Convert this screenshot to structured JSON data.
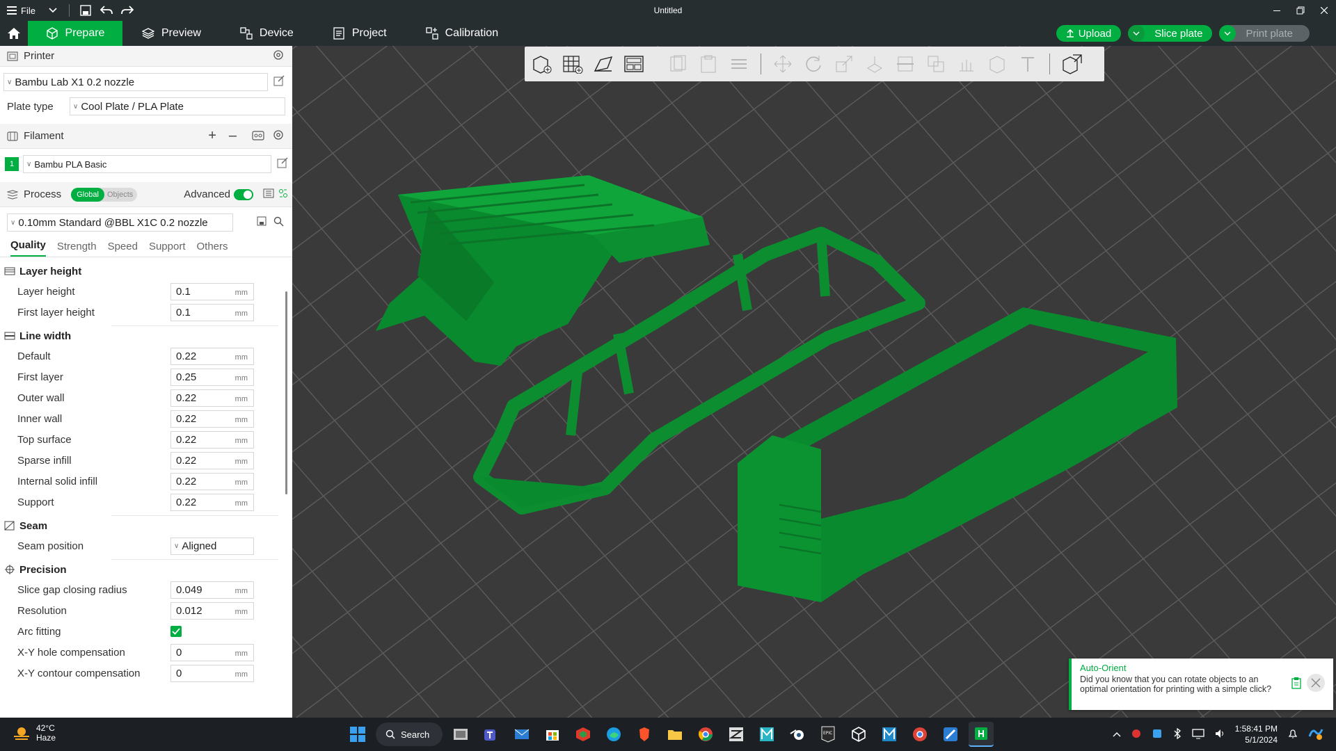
{
  "window": {
    "file_menu": "File",
    "title": "Untitled"
  },
  "nav": {
    "tabs": [
      {
        "label": "Prepare"
      },
      {
        "label": "Preview"
      },
      {
        "label": "Device"
      },
      {
        "label": "Project"
      },
      {
        "label": "Calibration"
      }
    ],
    "upload": "Upload",
    "slice": "Slice plate",
    "print": "Print plate"
  },
  "printer": {
    "section_label": "Printer",
    "name": "Bambu Lab X1 0.2 nozzle",
    "plate_label": "Plate type",
    "plate_value": "Cool Plate / PLA Plate"
  },
  "filament": {
    "section_label": "Filament",
    "slot": "1",
    "name": "Bambu PLA Basic",
    "slot_color": "#00ae42"
  },
  "process": {
    "section_label": "Process",
    "toggle_global": "Global",
    "toggle_objects": "Objects",
    "advanced_label": "Advanced",
    "preset": "0.10mm Standard @BBL X1C 0.2 nozzle",
    "tabs": [
      "Quality",
      "Strength",
      "Speed",
      "Support",
      "Others"
    ]
  },
  "quality": {
    "layer_height": {
      "title": "Layer height",
      "rows": [
        {
          "label": "Layer height",
          "value": "0.1",
          "unit": "mm"
        },
        {
          "label": "First layer height",
          "value": "0.1",
          "unit": "mm"
        }
      ]
    },
    "line_width": {
      "title": "Line width",
      "rows": [
        {
          "label": "Default",
          "value": "0.22",
          "unit": "mm"
        },
        {
          "label": "First layer",
          "value": "0.25",
          "unit": "mm"
        },
        {
          "label": "Outer wall",
          "value": "0.22",
          "unit": "mm"
        },
        {
          "label": "Inner wall",
          "value": "0.22",
          "unit": "mm"
        },
        {
          "label": "Top surface",
          "value": "0.22",
          "unit": "mm"
        },
        {
          "label": "Sparse infill",
          "value": "0.22",
          "unit": "mm"
        },
        {
          "label": "Internal solid infill",
          "value": "0.22",
          "unit": "mm"
        },
        {
          "label": "Support",
          "value": "0.22",
          "unit": "mm"
        }
      ]
    },
    "seam": {
      "title": "Seam",
      "label": "Seam position",
      "value": "Aligned"
    },
    "precision": {
      "title": "Precision",
      "rows": [
        {
          "label": "Slice gap closing radius",
          "value": "0.049",
          "unit": "mm"
        },
        {
          "label": "Resolution",
          "value": "0.012",
          "unit": "mm"
        }
      ],
      "arc_label": "Arc fitting",
      "arc_checked": true,
      "rows2": [
        {
          "label": "X-Y hole compensation",
          "value": "0",
          "unit": "mm"
        },
        {
          "label": "X-Y contour compensation",
          "value": "0",
          "unit": "mm"
        }
      ]
    }
  },
  "notification": {
    "title": "Auto-Orient",
    "text": "Did you know that you can rotate objects to an optimal orientation for printing with a simple click?"
  },
  "taskbar": {
    "temperature": "42°C",
    "condition": "Haze",
    "search_label": "Search",
    "time": "1:58:41 PM",
    "date": "5/1/2024"
  },
  "colors": {
    "accent": "#00ae42",
    "model": "#0a8a2e",
    "header_bg": "#262e30"
  }
}
